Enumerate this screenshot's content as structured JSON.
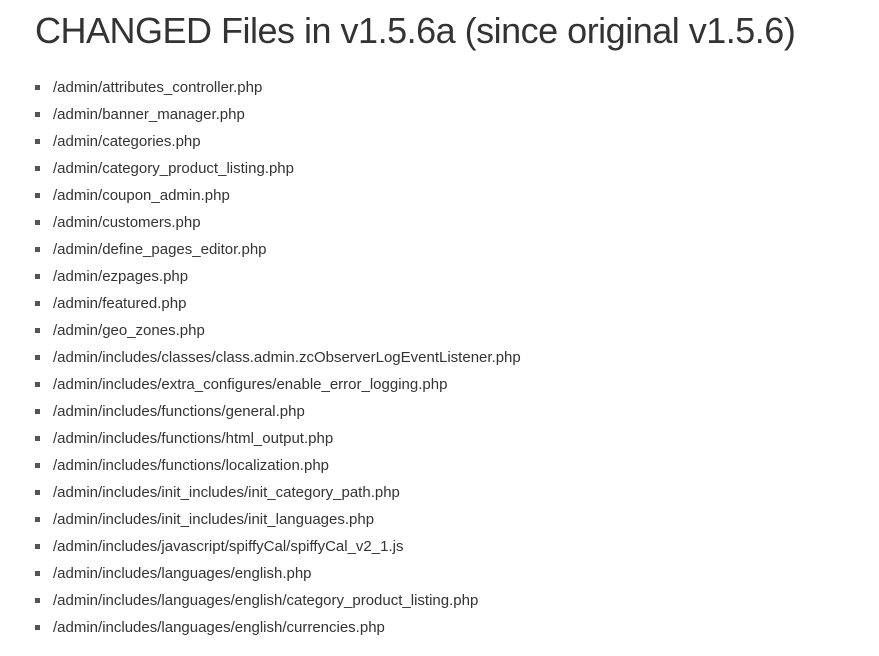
{
  "heading": "CHANGED Files in v1.5.6a (since original v1.5.6)",
  "files": [
    "/admin/attributes_controller.php",
    "/admin/banner_manager.php",
    "/admin/categories.php",
    "/admin/category_product_listing.php",
    "/admin/coupon_admin.php",
    "/admin/customers.php",
    "/admin/define_pages_editor.php",
    "/admin/ezpages.php",
    "/admin/featured.php",
    "/admin/geo_zones.php",
    "/admin/includes/classes/class.admin.zcObserverLogEventListener.php",
    "/admin/includes/extra_configures/enable_error_logging.php",
    "/admin/includes/functions/general.php",
    "/admin/includes/functions/html_output.php",
    "/admin/includes/functions/localization.php",
    "/admin/includes/init_includes/init_category_path.php",
    "/admin/includes/init_includes/init_languages.php",
    "/admin/includes/javascript/spiffyCal/spiffyCal_v2_1.js",
    "/admin/includes/languages/english.php",
    "/admin/includes/languages/english/category_product_listing.php",
    "/admin/includes/languages/english/currencies.php"
  ]
}
